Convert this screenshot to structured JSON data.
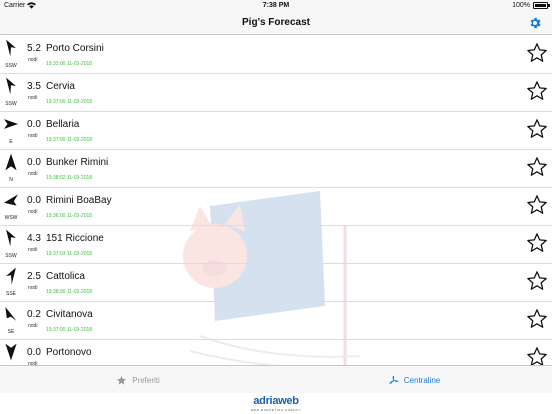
{
  "status_bar": {
    "carrier": "Carrier",
    "time": "7:38 PM",
    "battery": "100%"
  },
  "nav": {
    "title": "Pig's Forecast",
    "settings_icon": "gear-icon"
  },
  "stations": [
    {
      "speed": "5.2",
      "unit": "nodi",
      "name": "Porto Corsini",
      "direction": "SSW",
      "timestamp": "19:33:00 11-03-2018",
      "favorite": false,
      "arrow_icon": "wind-direction-arrow-icon"
    },
    {
      "speed": "3.5",
      "unit": "nodi",
      "name": "Cervia",
      "direction": "SSW",
      "timestamp": "19:37:00 11-03-2018",
      "favorite": false,
      "arrow_icon": "wind-direction-arrow-icon"
    },
    {
      "speed": "0.0",
      "unit": "nodi",
      "name": "Bellaria",
      "direction": "E",
      "timestamp": "19:37:00 11-03-2018",
      "favorite": false,
      "arrow_icon": "wind-direction-arrow-icon"
    },
    {
      "speed": "0.0",
      "unit": "nodi",
      "name": "Bunker Rimini",
      "direction": "N",
      "timestamp": "19:38:02 11-03-2018",
      "favorite": false,
      "arrow_icon": "wind-direction-arrow-icon"
    },
    {
      "speed": "0.0",
      "unit": "nodi",
      "name": "Rimini BoaBay",
      "direction": "WSW",
      "timestamp": "19:36:00 11-03-2018",
      "favorite": false,
      "arrow_icon": "wind-direction-arrow-icon"
    },
    {
      "speed": "4.3",
      "unit": "nodi",
      "name": "151 Riccione",
      "direction": "SSW",
      "timestamp": "19:37:03 11-03-2018",
      "favorite": false,
      "arrow_icon": "wind-direction-arrow-icon"
    },
    {
      "speed": "2.5",
      "unit": "nodi",
      "name": "Cattolica",
      "direction": "SSE",
      "timestamp": "19:38:00 11-03-2018",
      "favorite": false,
      "arrow_icon": "wind-direction-arrow-icon"
    },
    {
      "speed": "0.2",
      "unit": "nodi",
      "name": "Civitanova",
      "direction": "SE",
      "timestamp": "19:37:00 11-03-2018",
      "favorite": false,
      "arrow_icon": "wind-direction-arrow-icon"
    },
    {
      "speed": "0.0",
      "unit": "nodi",
      "name": "Portonovo",
      "direction": "",
      "timestamp": "",
      "favorite": false,
      "arrow_icon": "wind-direction-arrow-icon"
    }
  ],
  "tabs": [
    {
      "label": "Preferiti",
      "icon": "star-icon",
      "selected": false
    },
    {
      "label": "Centraline",
      "icon": "wind-turbine-icon",
      "selected": true
    }
  ],
  "footer": {
    "logo": "adriaweb",
    "tagline": "WEB MARKETING AGENCY"
  },
  "colors": {
    "accent": "#1a7bd6",
    "timestamp": "#3cbf3c",
    "inactive_tab": "#999999",
    "logo": "#1c5fa8"
  }
}
